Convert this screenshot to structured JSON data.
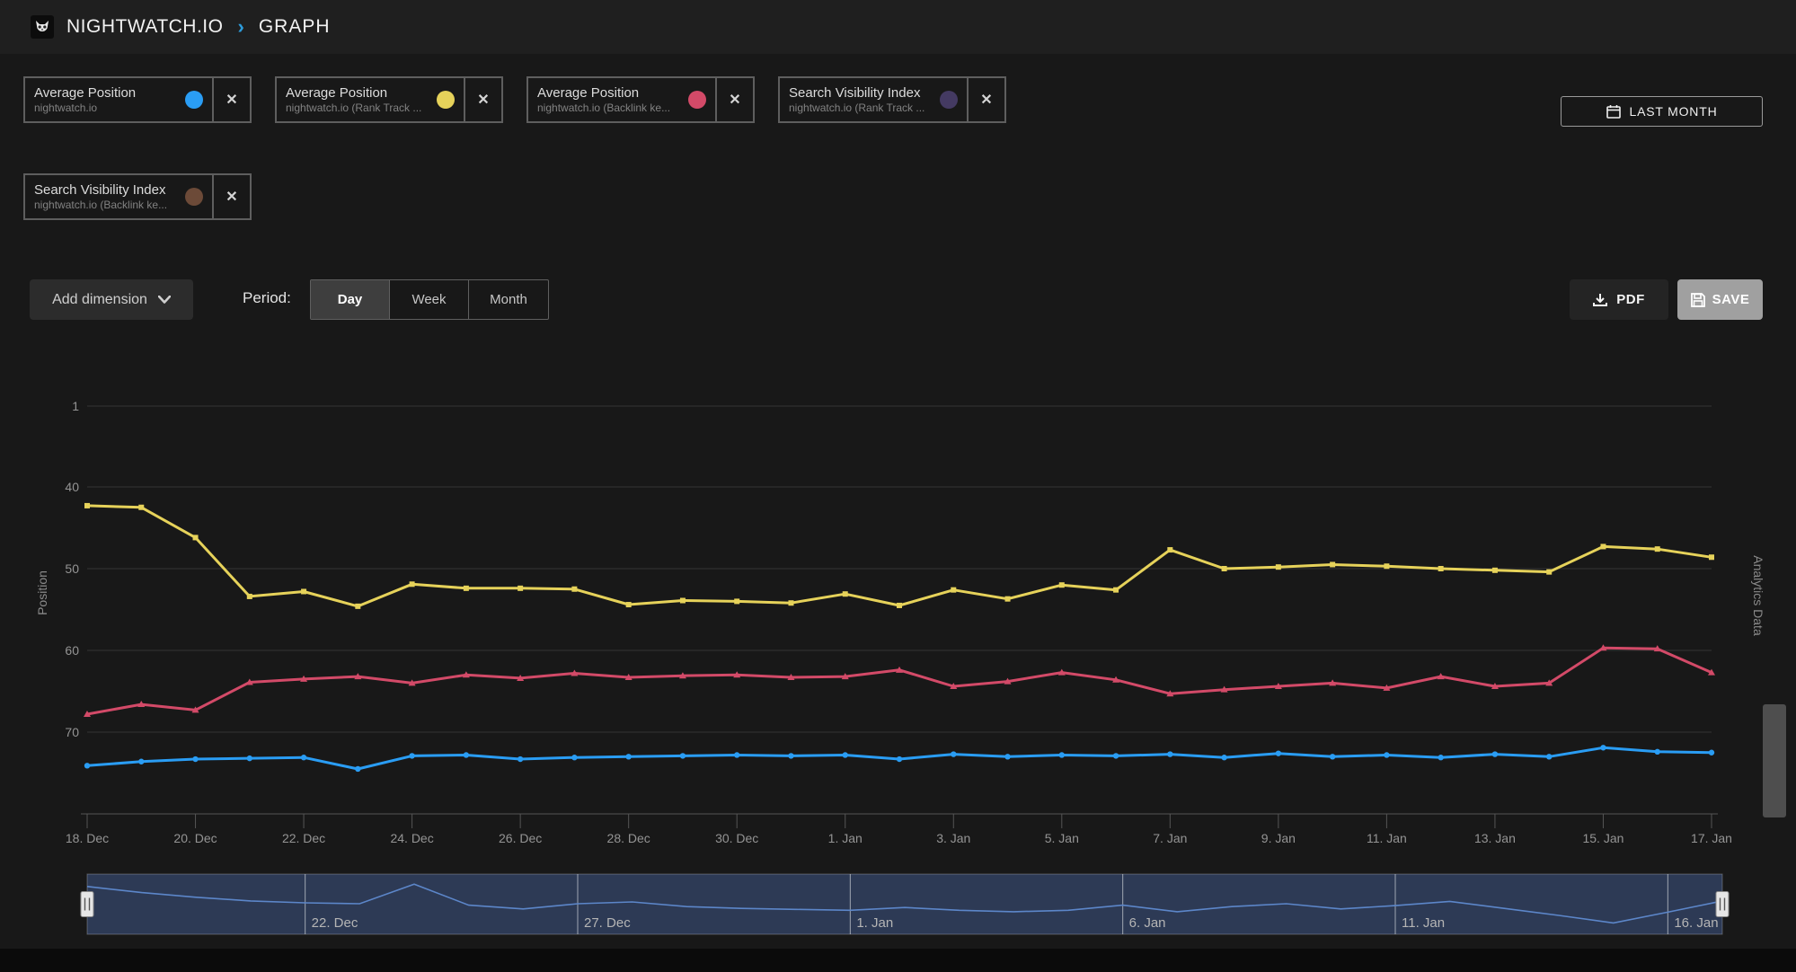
{
  "header": {
    "brand": "NIGHTWATCH.IO",
    "separator": "›",
    "page": "GRAPH"
  },
  "icons": {
    "close": "✕"
  },
  "chips": [
    {
      "title": "Average Position",
      "subtitle": "nightwatch.io",
      "color": "#2a9df4"
    },
    {
      "title": "Average Position",
      "subtitle": "nightwatch.io (Rank Track ...",
      "color": "#e6d25a"
    },
    {
      "title": "Average Position",
      "subtitle": "nightwatch.io (Backlink ke...",
      "color": "#d34a68"
    },
    {
      "title": "Search Visibility Index",
      "subtitle": "nightwatch.io (Rank Track ...",
      "color": "#443a62"
    },
    {
      "title": "Search Visibility Index",
      "subtitle": "nightwatch.io (Backlink ke...",
      "color": "#6c4a38"
    }
  ],
  "date_range_button": {
    "label": "LAST MONTH"
  },
  "controls": {
    "add_dimension": "Add dimension",
    "period_label": "Period:",
    "periods": [
      "Day",
      "Week",
      "Month"
    ],
    "active_period": "Day",
    "pdf": "PDF",
    "save": "SAVE"
  },
  "chart_data": {
    "type": "line",
    "ylabel": "Position",
    "ylabel_right": "Analytics Data",
    "y_ticks": [
      1,
      40,
      50,
      60,
      70
    ],
    "y_inverted": true,
    "x_start": "18. Dec",
    "x_end": "17. Jan",
    "x_step_days": 1,
    "x_tick_labels": [
      "18. Dec",
      "20. Dec",
      "22. Dec",
      "24. Dec",
      "26. Dec",
      "28. Dec",
      "30. Dec",
      "1. Jan",
      "3. Jan",
      "5. Jan",
      "7. Jan",
      "9. Jan",
      "11. Jan",
      "13. Jan",
      "15. Jan",
      "17. Jan"
    ],
    "series": [
      {
        "name": "Average Position — nightwatch.io",
        "color": "#2a9df4",
        "marker": "circle",
        "values": [
          74.1,
          73.6,
          73.3,
          73.2,
          73.1,
          74.5,
          72.9,
          72.8,
          73.3,
          73.1,
          73.0,
          72.9,
          72.8,
          72.9,
          72.8,
          73.3,
          72.7,
          73.0,
          72.8,
          72.9,
          72.7,
          73.1,
          72.6,
          73.0,
          72.8,
          73.1,
          72.7,
          73.0,
          71.9,
          72.4,
          72.5
        ]
      },
      {
        "name": "Average Position — nightwatch.io (Rank Tracker)",
        "color": "#e6d25a",
        "marker": "square",
        "values": [
          42.3,
          42.5,
          46.2,
          53.4,
          52.8,
          54.6,
          51.9,
          52.4,
          52.4,
          52.5,
          54.4,
          53.9,
          54.0,
          54.2,
          53.1,
          54.5,
          52.6,
          53.7,
          52.0,
          52.6,
          47.7,
          50.0,
          49.8,
          49.5,
          49.7,
          50.0,
          50.2,
          50.4,
          47.3,
          47.6,
          48.6
        ]
      },
      {
        "name": "Average Position — nightwatch.io (Backlink keywords)",
        "color": "#d34a68",
        "marker": "triangle",
        "values": [
          67.8,
          66.6,
          67.3,
          63.9,
          63.5,
          63.2,
          64.0,
          63.0,
          63.4,
          62.8,
          63.3,
          63.1,
          63.0,
          63.3,
          63.2,
          62.4,
          64.4,
          63.8,
          62.7,
          63.6,
          65.3,
          64.8,
          64.4,
          64.0,
          64.6,
          63.2,
          64.4,
          64.0,
          59.7,
          59.8,
          62.7
        ]
      }
    ],
    "navigator": {
      "labels": [
        "22. Dec",
        "27. Dec",
        "1. Jan",
        "6. Jan",
        "11. Jan",
        "16. Jan"
      ],
      "gridline_days": [
        4,
        9,
        14,
        19,
        24,
        29
      ],
      "values": [
        0.15,
        0.28,
        0.38,
        0.46,
        0.5,
        0.52,
        0.1,
        0.55,
        0.63,
        0.52,
        0.48,
        0.58,
        0.62,
        0.64,
        0.66,
        0.6,
        0.66,
        0.69,
        0.66,
        0.55,
        0.69,
        0.58,
        0.52,
        0.63,
        0.56,
        0.47,
        0.62,
        0.77,
        0.93,
        0.7,
        0.46
      ],
      "line_color": "#5c86c9",
      "background": "#2d3a55"
    },
    "grid_color": "#333333",
    "axis_color": "#555555",
    "label_color": "#949494"
  }
}
